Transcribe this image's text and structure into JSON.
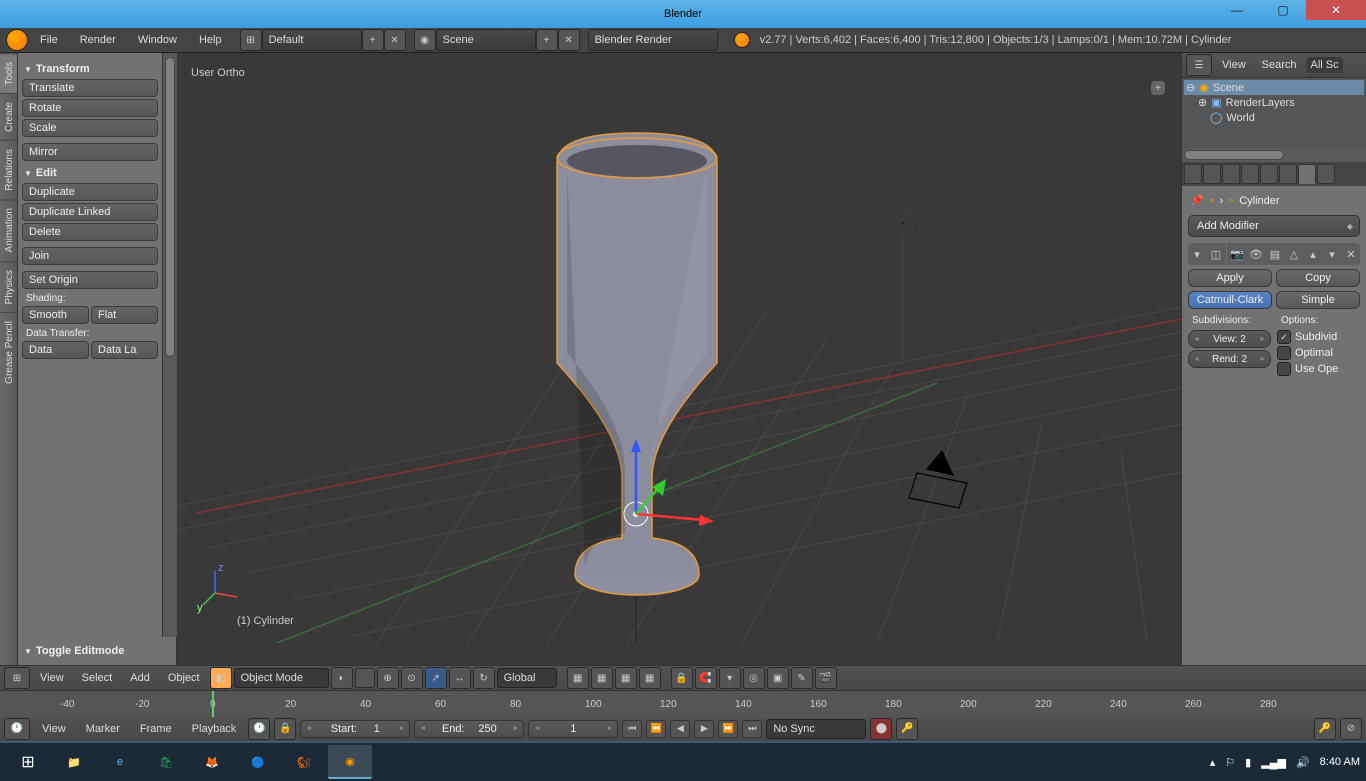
{
  "window": {
    "title": "Blender"
  },
  "info_header": {
    "menus": [
      "File",
      "Render",
      "Window",
      "Help"
    ],
    "layout": "Default",
    "scene": "Scene",
    "engine": "Blender Render",
    "stats": "v2.77 | Verts:6,402 | Faces:6,400 | Tris:12,800 | Objects:1/3 | Lamps:0/1 | Mem:10.72M | Cylinder"
  },
  "toolshelf": {
    "tabs": [
      "Tools",
      "Create",
      "Relations",
      "Animation",
      "Physics",
      "Grease Pencil"
    ],
    "transform_header": "Transform",
    "translate": "Translate",
    "rotate": "Rotate",
    "scale": "Scale",
    "mirror": "Mirror",
    "edit_header": "Edit",
    "duplicate": "Duplicate",
    "duplicate_linked": "Duplicate Linked",
    "delete": "Delete",
    "join": "Join",
    "set_origin": "Set Origin",
    "shading_label": "Shading:",
    "smooth": "Smooth",
    "flat": "Flat",
    "data_transfer_label": "Data Transfer:",
    "data": "Data",
    "data_layout": "Data La",
    "operator_header": "Toggle Editmode"
  },
  "viewport": {
    "view_label": "User Ortho",
    "object_label": "(1) Cylinder",
    "header_menus": [
      "View",
      "Select",
      "Add",
      "Object"
    ],
    "mode": "Object Mode",
    "orientation": "Global"
  },
  "outliner": {
    "menus": [
      "View",
      "Search",
      "All Sc"
    ],
    "scene": "Scene",
    "renderlayers": "RenderLayers",
    "world": "World"
  },
  "properties": {
    "breadcrumb_obj": "Cylinder",
    "add_modifier": "Add Modifier",
    "apply": "Apply",
    "copy": "Copy",
    "subdiv_type_a": "Catmull-Clark",
    "subdiv_type_b": "Simple",
    "subdivisions_label": "Subdivisions:",
    "options_label": "Options:",
    "view_val": "View: 2",
    "render_val": "Rend: 2",
    "opt_subdivide": "Subdivid",
    "opt_optimal": "Optimal",
    "opt_use_ope": "Use Ope"
  },
  "timeline": {
    "menus": [
      "View",
      "Marker",
      "Frame",
      "Playback"
    ],
    "start_label": "Start:",
    "start_val": "1",
    "end_label": "End:",
    "end_val": "250",
    "current": "1",
    "sync": "No Sync",
    "ticks": [
      -40,
      -20,
      0,
      20,
      40,
      60,
      80,
      100,
      120,
      140,
      160,
      180,
      200,
      220,
      240,
      260,
      280
    ]
  },
  "taskbar": {
    "time": "8:40 AM"
  }
}
